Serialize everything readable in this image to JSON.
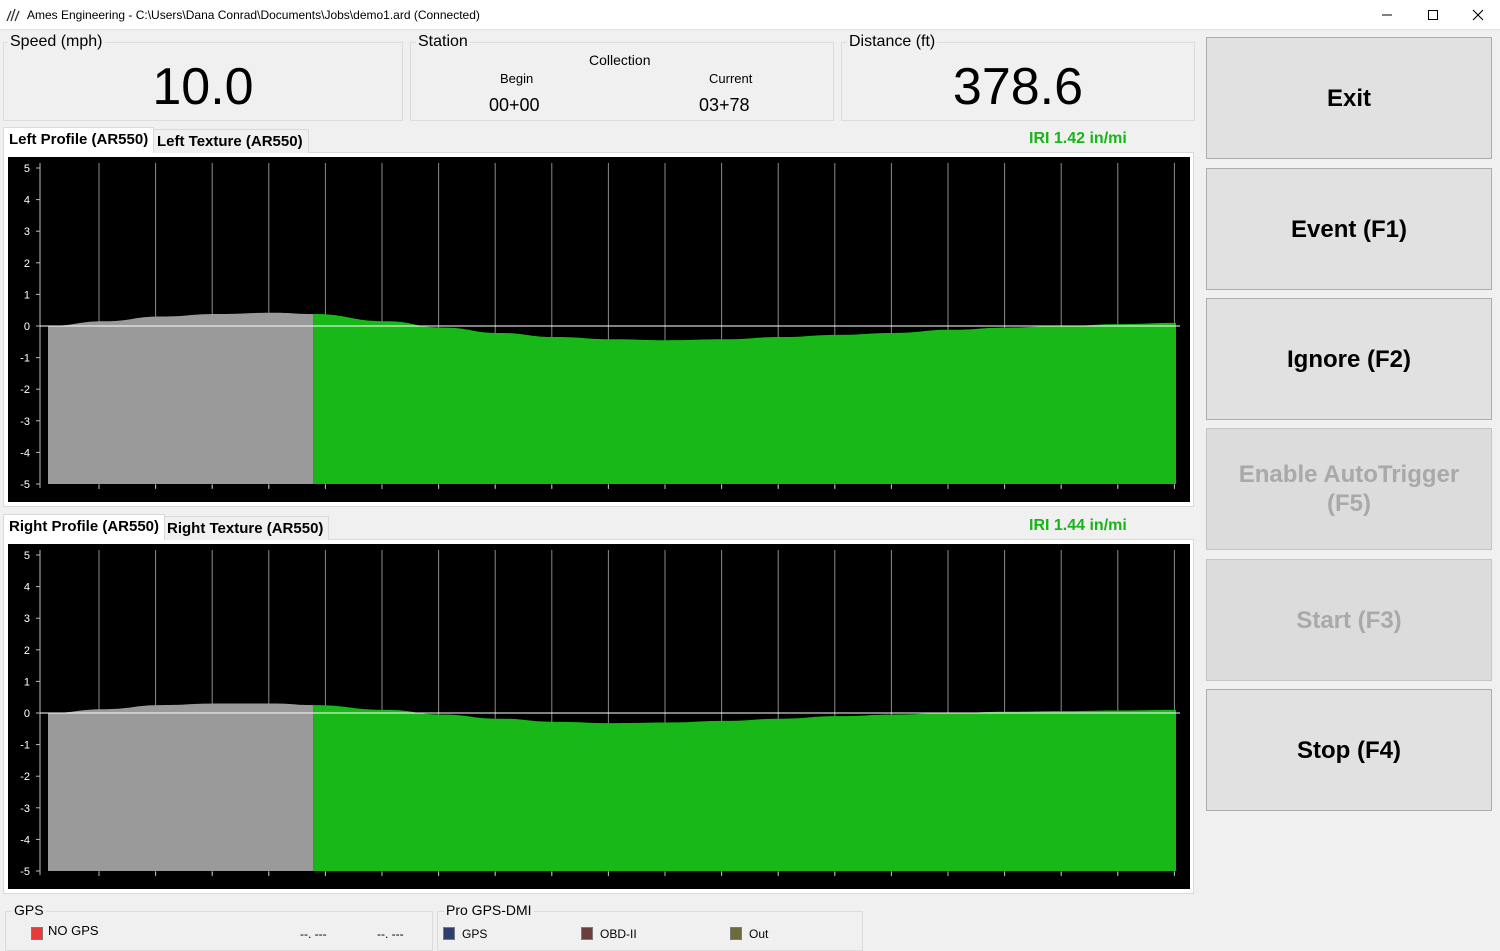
{
  "window": {
    "title": "Ames Engineering - C:\\Users\\Dana Conrad\\Documents\\Jobs\\demo1.ard (Connected)"
  },
  "speed": {
    "label": "Speed (mph)",
    "value": "10.0"
  },
  "station": {
    "label": "Station",
    "collection_label": "Collection",
    "begin_label": "Begin",
    "begin_value": "00+00",
    "current_label": "Current",
    "current_value": "03+78"
  },
  "distance": {
    "label": "Distance (ft)",
    "value": "378.6"
  },
  "left": {
    "tabs": [
      "Left Profile (AR550)",
      "Left Texture (AR550)"
    ],
    "active_tab": 0,
    "iri": "IRI 1.42 in/mi"
  },
  "right": {
    "tabs": [
      "Right Profile (AR550)",
      "Right Texture (AR550)"
    ],
    "active_tab": 0,
    "iri": "IRI 1.44 in/mi"
  },
  "chart_data": [
    {
      "type": "area",
      "panel": "left-profile",
      "ylim": [
        -5,
        5
      ],
      "yticks": [
        "5",
        "4",
        "3",
        "2",
        "1",
        "0",
        "-1",
        "-2",
        "-3",
        "-4",
        "-5"
      ],
      "grid": "vertical",
      "baseline": -5,
      "gray_end_x": 0.235,
      "x": [
        0,
        0.05,
        0.1,
        0.15,
        0.2,
        0.235,
        0.3,
        0.35,
        0.4,
        0.45,
        0.5,
        0.55,
        0.6,
        0.65,
        0.7,
        0.75,
        0.8,
        0.85,
        0.9,
        0.95,
        1.0
      ],
      "values": [
        0,
        0.15,
        0.3,
        0.38,
        0.42,
        0.38,
        0.15,
        -0.05,
        -0.22,
        -0.35,
        -0.42,
        -0.45,
        -0.42,
        -0.35,
        -0.28,
        -0.22,
        -0.12,
        -0.05,
        0.0,
        0.06,
        0.1
      ],
      "colors": {
        "recorded": "#18b818",
        "preview": "#9a9a9a",
        "zero_line": "#ffffff",
        "background": "#000000"
      }
    },
    {
      "type": "area",
      "panel": "right-profile",
      "ylim": [
        -5,
        5
      ],
      "yticks": [
        "5",
        "4",
        "3",
        "2",
        "1",
        "0",
        "-1",
        "-2",
        "-3",
        "-4",
        "-5"
      ],
      "grid": "vertical",
      "baseline": -5,
      "gray_end_x": 0.235,
      "x": [
        0,
        0.05,
        0.1,
        0.15,
        0.2,
        0.235,
        0.3,
        0.35,
        0.4,
        0.45,
        0.5,
        0.55,
        0.6,
        0.65,
        0.7,
        0.75,
        0.8,
        0.85,
        0.9,
        0.95,
        1.0
      ],
      "values": [
        0,
        0.12,
        0.25,
        0.3,
        0.3,
        0.25,
        0.1,
        -0.05,
        -0.18,
        -0.28,
        -0.32,
        -0.3,
        -0.25,
        -0.18,
        -0.1,
        -0.05,
        0.0,
        0.04,
        0.06,
        0.08,
        0.1
      ],
      "colors": {
        "recorded": "#18b818",
        "preview": "#9a9a9a",
        "zero_line": "#ffffff",
        "background": "#000000"
      }
    }
  ],
  "buttons": [
    {
      "label": "Exit",
      "enabled": true
    },
    {
      "label": "Event (F1)",
      "enabled": true
    },
    {
      "label": "Ignore (F2)",
      "enabled": true
    },
    {
      "label": "Enable AutoTrigger (F5)",
      "enabled": false
    },
    {
      "label": "Start (F3)",
      "enabled": false
    },
    {
      "label": "Stop (F4)",
      "enabled": true
    }
  ],
  "gps": {
    "label": "GPS",
    "status": "NO GPS",
    "status_color": "#e83a3a",
    "lat": "--. ---",
    "lon": "--. ---"
  },
  "pro_gps_dmi": {
    "label": "Pro GPS-DMI",
    "indicators": [
      {
        "label": "GPS",
        "color": "#2e3f6e"
      },
      {
        "label": "OBD-II",
        "color": "#6b3e3e"
      },
      {
        "label": "Out",
        "color": "#6e6b3a"
      }
    ]
  }
}
